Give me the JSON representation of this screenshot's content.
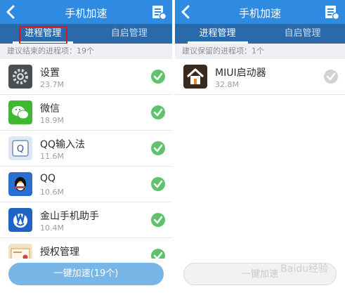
{
  "left": {
    "title": "手机加速",
    "tabs": [
      {
        "label": "进程管理"
      },
      {
        "label": "自启管理"
      }
    ],
    "section_label": "建议结束的进程项：19个",
    "apps": [
      {
        "name": "设置",
        "size": "23.7M",
        "icon": "settings-icon"
      },
      {
        "name": "微信",
        "size": "18.9M",
        "icon": "wechat-icon"
      },
      {
        "name": "QQ输入法",
        "size": "11.6M",
        "icon": "qq-input-icon"
      },
      {
        "name": "QQ",
        "size": "10.6M",
        "icon": "qq-icon"
      },
      {
        "name": "金山手机助手",
        "size": "10.4M",
        "icon": "kingsoft-assistant-icon"
      },
      {
        "name": "授权管理",
        "size": "",
        "icon": "auth-manager-icon"
      }
    ],
    "boost_button": "一键加速(19个)"
  },
  "right": {
    "title": "手机加速",
    "tabs": [
      {
        "label": "进程管理"
      },
      {
        "label": "自启管理"
      }
    ],
    "section_label": "建议保留的进程项：1个",
    "apps": [
      {
        "name": "MIUI启动器",
        "size": "32.8M",
        "icon": "miui-launcher-icon"
      }
    ],
    "boost_button": "一键加速"
  },
  "watermark": "Baidu经验",
  "colors": {
    "titlebar": "#2f8be2",
    "tabbar": "#2a6aab",
    "check_green": "#5fc36b",
    "check_gray": "#cfd3d6",
    "highlight": "#e0141f"
  }
}
